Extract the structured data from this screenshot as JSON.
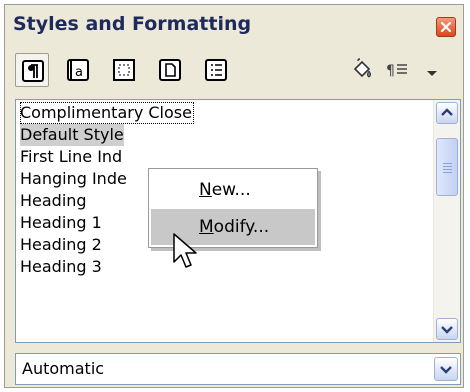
{
  "window": {
    "title": "Styles and Formatting"
  },
  "toolbar": {
    "tools": [
      {
        "icon": "paragraph-styles-icon",
        "active": true
      },
      {
        "icon": "character-styles-icon",
        "active": false
      },
      {
        "icon": "frame-styles-icon",
        "active": false
      },
      {
        "icon": "page-styles-icon",
        "active": false
      },
      {
        "icon": "list-styles-icon",
        "active": false
      },
      {
        "icon": "fill-format-mode-icon",
        "active": false
      },
      {
        "icon": "new-style-from-selection-icon",
        "active": false
      },
      {
        "icon": "dropdown-arrow-icon",
        "active": false
      }
    ]
  },
  "style_list": {
    "items": [
      "Complimentary Close",
      "Default Style",
      "First Line Ind",
      "Hanging Inde",
      "Heading",
      "Heading 1",
      "Heading 2",
      "Heading 3"
    ],
    "focused_index": 0,
    "selected_index": 1
  },
  "context_menu": {
    "items": [
      {
        "accel": "N",
        "rest": "ew..."
      },
      {
        "accel": "M",
        "rest": "odify..."
      }
    ],
    "hover_index": 1
  },
  "filter_dropdown": {
    "value": "Automatic"
  }
}
